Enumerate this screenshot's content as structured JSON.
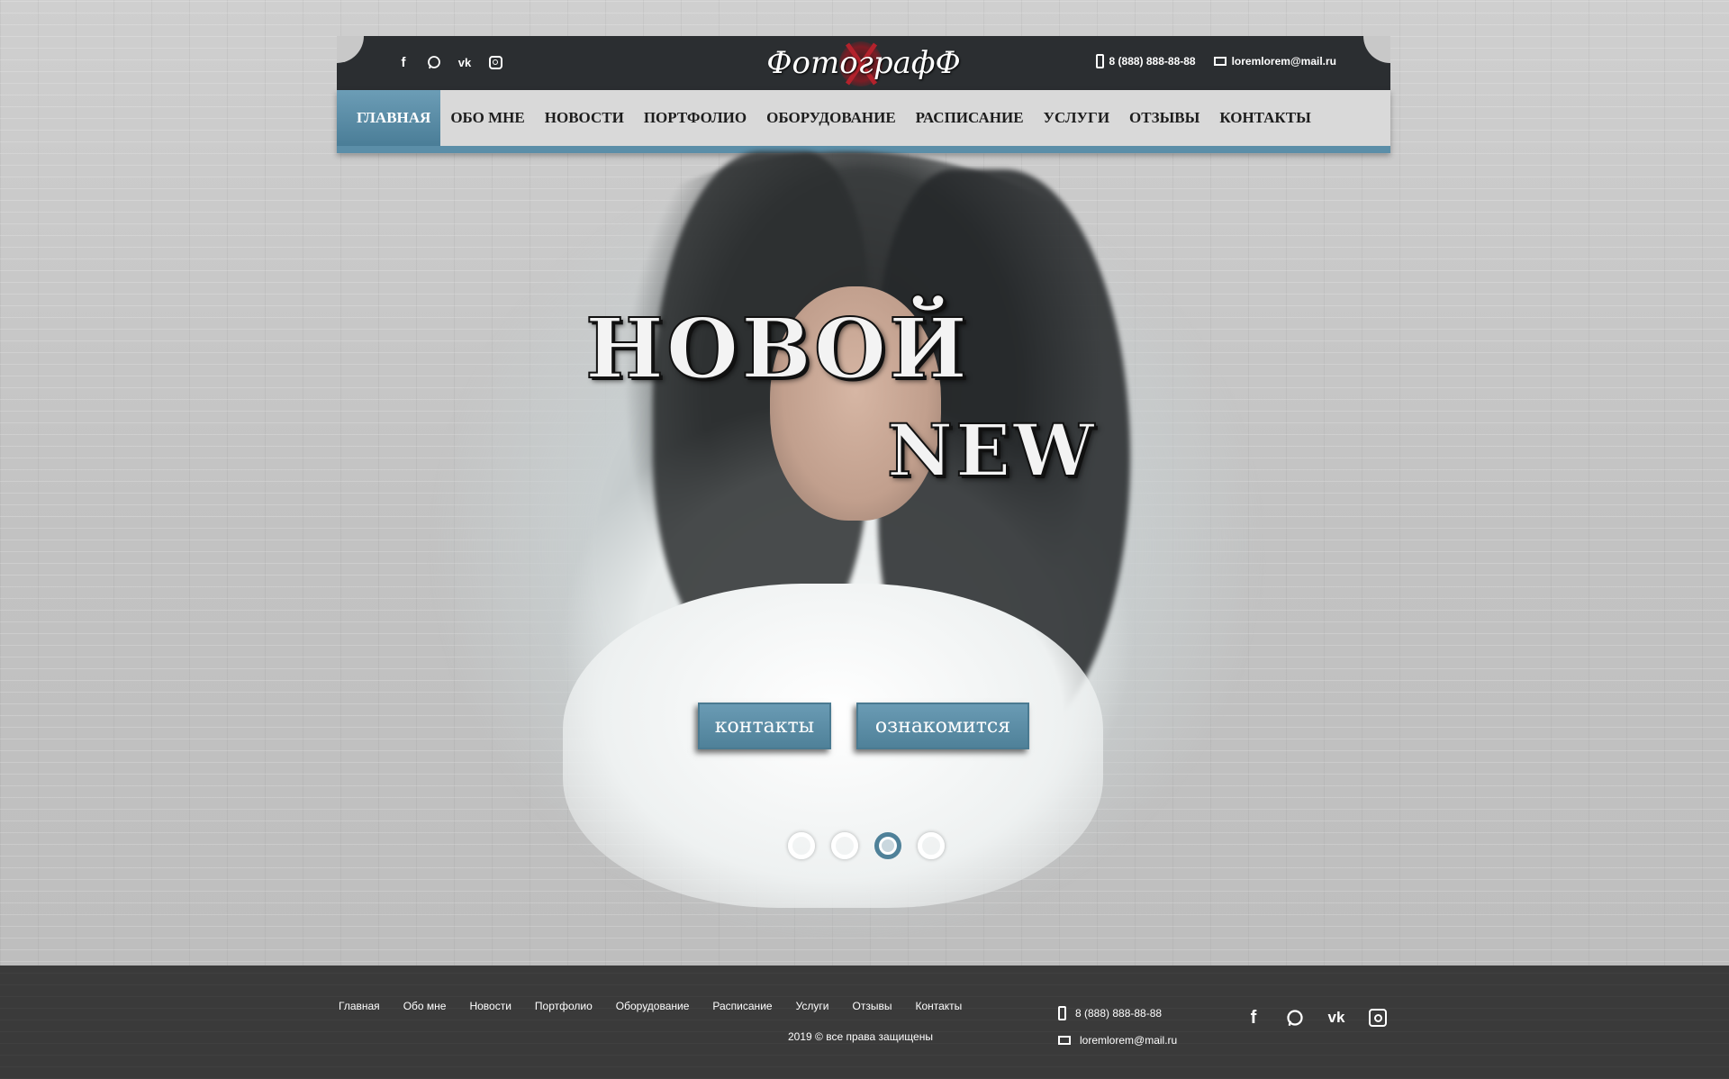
{
  "header": {
    "logo_text": "ФотографФ",
    "social": [
      "facebook-icon",
      "whatsapp-icon",
      "vk-icon",
      "instagram-icon"
    ],
    "phone": "8 (888) 888-88-88",
    "email": "loremlorem@mail.ru"
  },
  "nav": {
    "items": [
      {
        "label": "ГЛАВНАЯ",
        "active": true
      },
      {
        "label": "ОБО МНЕ"
      },
      {
        "label": "НОВОСТИ"
      },
      {
        "label": "ПОРТФОЛИО"
      },
      {
        "label": "ОБОРУДОВАНИЕ"
      },
      {
        "label": "РАСПИСАНИЕ"
      },
      {
        "label": "УСЛУГИ"
      },
      {
        "label": "ОТЗЫВЫ"
      },
      {
        "label": "КОНТАКТЫ"
      }
    ]
  },
  "hero": {
    "headline_1": "НОВОЙ",
    "headline_2": "NEW",
    "button_contacts": "контакты",
    "button_learn": "ознакомится",
    "slides_count": 4,
    "active_slide": 3
  },
  "footer": {
    "nav": [
      "Главная",
      "Обо мне",
      "Новости",
      "Портфолио",
      "Оборудование",
      "Расписание",
      "Услуги",
      "Отзывы",
      "Контакты"
    ],
    "copyright": "2019 © все права защищены",
    "phone": "8 (888) 888-88-88",
    "email": "loremlorem@mail.ru"
  },
  "colors": {
    "accent": "#5b8ea8",
    "topbar": "#2b2e31",
    "footer": "#3a3a3a"
  }
}
